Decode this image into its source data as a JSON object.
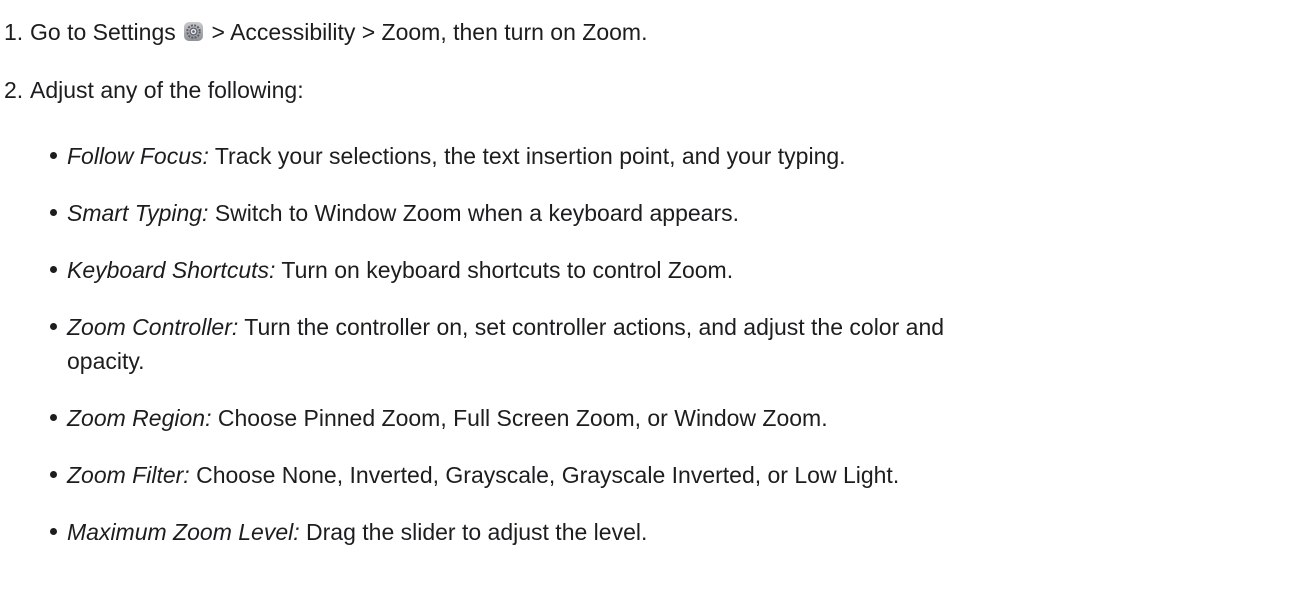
{
  "steps": [
    {
      "number": "1.",
      "text_before": "Go to Settings",
      "icon": "settings-gear-icon",
      "text_after": "> Accessibility > Zoom, then turn on Zoom."
    },
    {
      "number": "2.",
      "text": "Adjust any of the following:"
    }
  ],
  "options": [
    {
      "term": "Follow Focus:",
      "desc": "Track your selections, the text insertion point, and your typing."
    },
    {
      "term": "Smart Typing:",
      "desc": "Switch to Window Zoom when a keyboard appears."
    },
    {
      "term": "Keyboard Shortcuts:",
      "desc": "Turn on keyboard shortcuts to control Zoom."
    },
    {
      "term": "Zoom Controller:",
      "desc": "Turn the controller on, set controller actions, and adjust the color and",
      "desc_cont": "opacity."
    },
    {
      "term": "Zoom Region:",
      "desc": "Choose Pinned Zoom, Full Screen Zoom, or Window Zoom."
    },
    {
      "term": "Zoom Filter:",
      "desc": "Choose None, Inverted, Grayscale, Grayscale Inverted, or Low Light."
    },
    {
      "term": "Maximum Zoom Level:",
      "desc": "Drag the slider to adjust the level."
    }
  ]
}
